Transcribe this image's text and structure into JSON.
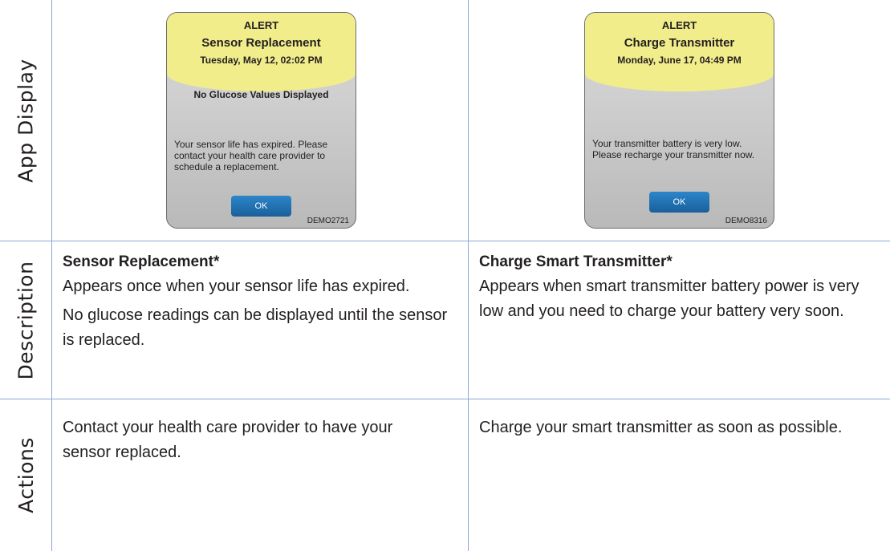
{
  "row_labels": {
    "app_display": "App Display",
    "description": "Description",
    "actions": "Actions"
  },
  "left": {
    "screen": {
      "alert_title": "ALERT",
      "alert_name": "Sensor Replacement",
      "alert_date": "Tuesday, May 12, 02:02 PM",
      "headline": "No Glucose Values Displayed",
      "message": "Your sensor life has expired. Please contact your health care provider to schedule a replacement.",
      "ok_label": "OK",
      "code": "DEMO2721"
    },
    "description_title": "Sensor Replacement*",
    "description_line1": "Appears once when your sensor life has expired.",
    "description_line2": "No glucose readings can be displayed until the sensor is replaced.",
    "action": "Contact your health care provider to have your sensor replaced."
  },
  "right": {
    "screen": {
      "alert_title": "ALERT",
      "alert_name": "Charge Transmitter",
      "alert_date": "Monday, June 17, 04:49 PM",
      "message": "Your transmitter battery is very low. Please recharge your transmitter now.",
      "ok_label": "OK",
      "code": "DEMO8316"
    },
    "description_title": "Charge Smart Transmitter*",
    "description_line1": "Appears when smart transmitter battery power is very low and you need to charge your battery very soon.",
    "action": "Charge your smart transmitter as soon as possible."
  },
  "colors": {
    "grid_line": "#8aa9d4",
    "alert_banner": "#f1ed8b",
    "ok_button": "#1f6fb2"
  }
}
